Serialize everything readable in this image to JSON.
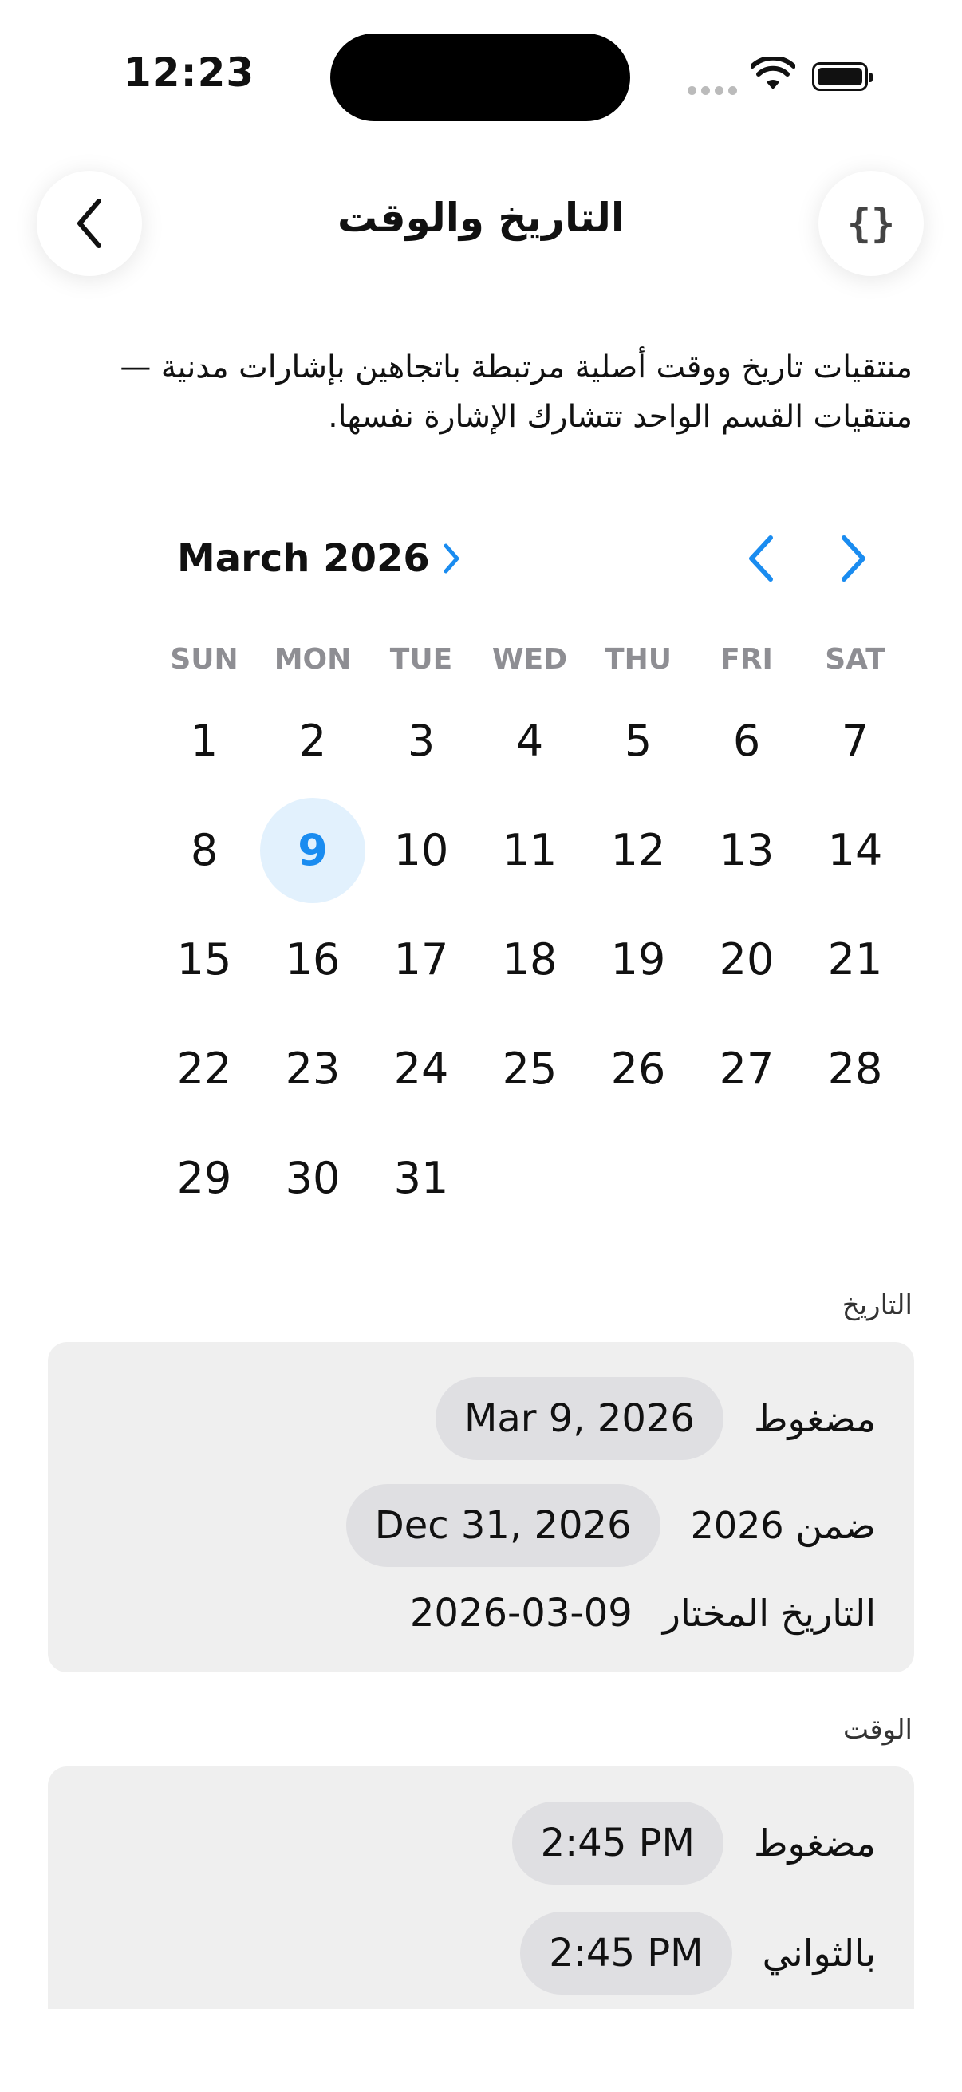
{
  "status_bar": {
    "time": "12:23"
  },
  "nav": {
    "title": "التاريخ والوقت",
    "code_icon": "{}"
  },
  "description": "منتقيات تاريخ ووقت أصلية مرتبطة باتجاهين بإشارات مدنية — منتقيات القسم الواحد تتشارك الإشارة نفسها.",
  "calendar": {
    "month_label": "March 2026",
    "weekdays": [
      "SUN",
      "MON",
      "TUE",
      "WED",
      "THU",
      "FRI",
      "SAT"
    ],
    "days": [
      "1",
      "2",
      "3",
      "4",
      "5",
      "6",
      "7",
      "8",
      "9",
      "10",
      "11",
      "12",
      "13",
      "14",
      "15",
      "16",
      "17",
      "18",
      "19",
      "20",
      "21",
      "22",
      "23",
      "24",
      "25",
      "26",
      "27",
      "28",
      "29",
      "30",
      "31"
    ],
    "selected_day": "9",
    "accent_color": "#1a8cf0"
  },
  "date_section": {
    "header": "التاريخ",
    "compact_label": "مضغوط",
    "compact_value": "Mar 9, 2026",
    "within_label": "ضمن 2026",
    "within_value": "Dec 31, 2026",
    "selected_label": "التاريخ المختار",
    "selected_value": "2026-03-09"
  },
  "time_section": {
    "header": "الوقت",
    "compact_label": "مضغوط",
    "compact_value": "2:45 PM",
    "seconds_label": "بالثواني",
    "seconds_value": "2:45 PM"
  }
}
